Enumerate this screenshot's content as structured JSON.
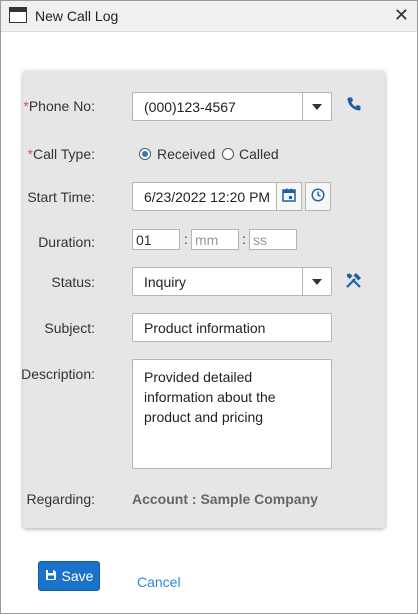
{
  "window": {
    "title": "New Call Log"
  },
  "form": {
    "phone": {
      "label": "Phone No:",
      "required_mark": "*",
      "value": "(000)123-4567"
    },
    "call_type": {
      "label": "Call Type:",
      "required_mark": "*",
      "options": [
        "Received",
        "Called"
      ],
      "selected": "Received"
    },
    "start_time": {
      "label": "Start Time:",
      "value": "6/23/2022 12:20 PM"
    },
    "duration": {
      "label": "Duration:",
      "hours": "01",
      "minutes_placeholder": "mm",
      "seconds_placeholder": "ss",
      "separator": ":"
    },
    "status": {
      "label": "Status:",
      "value": "Inquiry"
    },
    "subject": {
      "label": "Subject:",
      "value": "Product information"
    },
    "description": {
      "label": "Description:",
      "value": "Provided detailed information about the product and pricing"
    },
    "regarding": {
      "label": "Regarding:",
      "value": "Account : Sample Company"
    }
  },
  "actions": {
    "save": "Save",
    "cancel": "Cancel"
  },
  "colors": {
    "accent": "#1a73c9",
    "link": "#2a8bd0",
    "required": "#d9534f",
    "icon": "#1e5fa8"
  },
  "icons": [
    "window-icon",
    "close-icon",
    "phone-icon",
    "calendar-icon",
    "clock-icon",
    "tools-icon",
    "disk-icon"
  ]
}
